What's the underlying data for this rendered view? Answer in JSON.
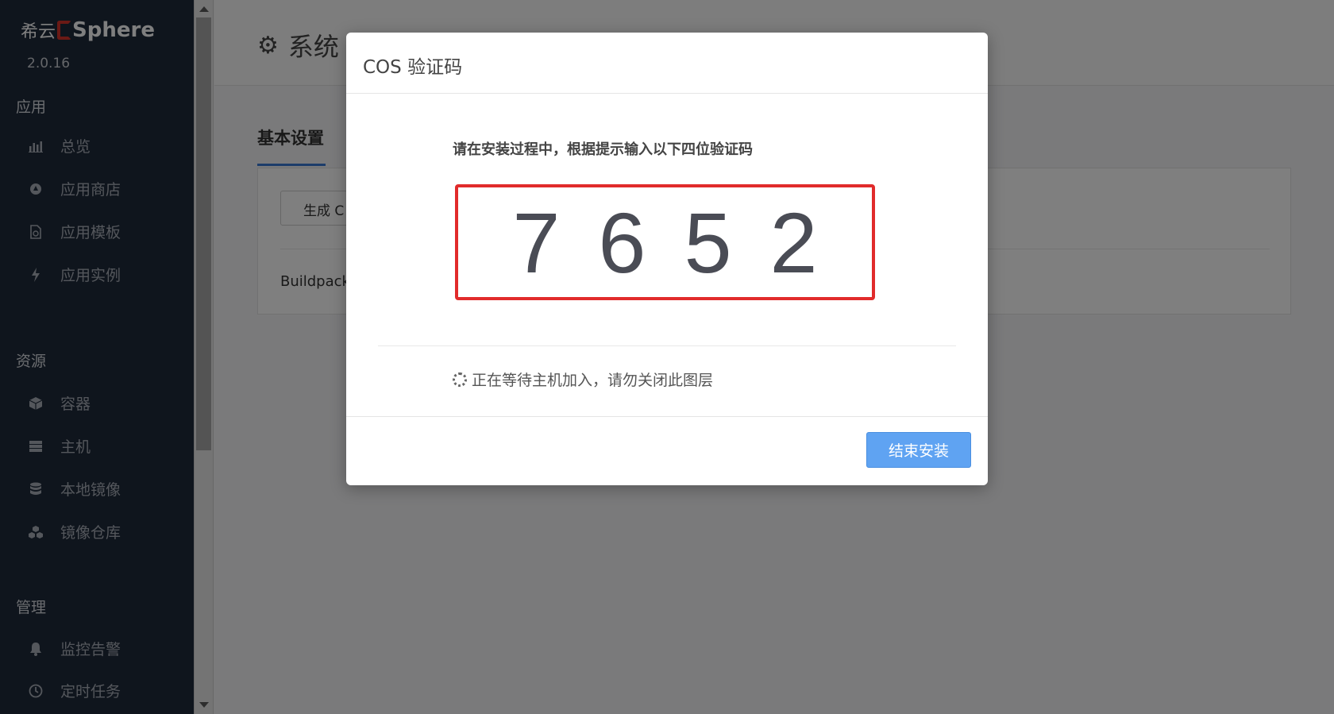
{
  "sidebar": {
    "logo_pre": "希云",
    "logo_text": "Sphere",
    "version": "2.0.16",
    "sections": [
      {
        "label": "应用",
        "items": [
          {
            "label": "总览",
            "icon": "bar-chart-icon"
          },
          {
            "label": "应用商店",
            "icon": "store-icon"
          },
          {
            "label": "应用模板",
            "icon": "template-icon"
          },
          {
            "label": "应用实例",
            "icon": "bolt-icon"
          }
        ]
      },
      {
        "label": "资源",
        "items": [
          {
            "label": "容器",
            "icon": "cube-icon"
          },
          {
            "label": "主机",
            "icon": "server-icon"
          },
          {
            "label": "本地镜像",
            "icon": "database-icon"
          },
          {
            "label": "镜像仓库",
            "icon": "cubes-icon"
          }
        ]
      },
      {
        "label": "管理",
        "items": [
          {
            "label": "监控告警",
            "icon": "bell-icon"
          },
          {
            "label": "定时任务",
            "icon": "clock-icon"
          }
        ]
      }
    ]
  },
  "page": {
    "title": "系统",
    "tab": "基本设置",
    "generate_button": "生成 C",
    "buildpack_label": "Buildpack"
  },
  "modal": {
    "title": "COS 验证码",
    "instruction": "请在安装过程中，根据提示输入以下四位验证码",
    "code": "7652",
    "waiting_text": "正在等待主机加入，请勿关闭此图层",
    "end_button": "结束安装"
  },
  "colors": {
    "sidebar_bg": "#1f2a3a",
    "code_border": "#e12b2b",
    "primary_button": "#5fa3f2",
    "tab_underline": "#3a7bd5"
  }
}
